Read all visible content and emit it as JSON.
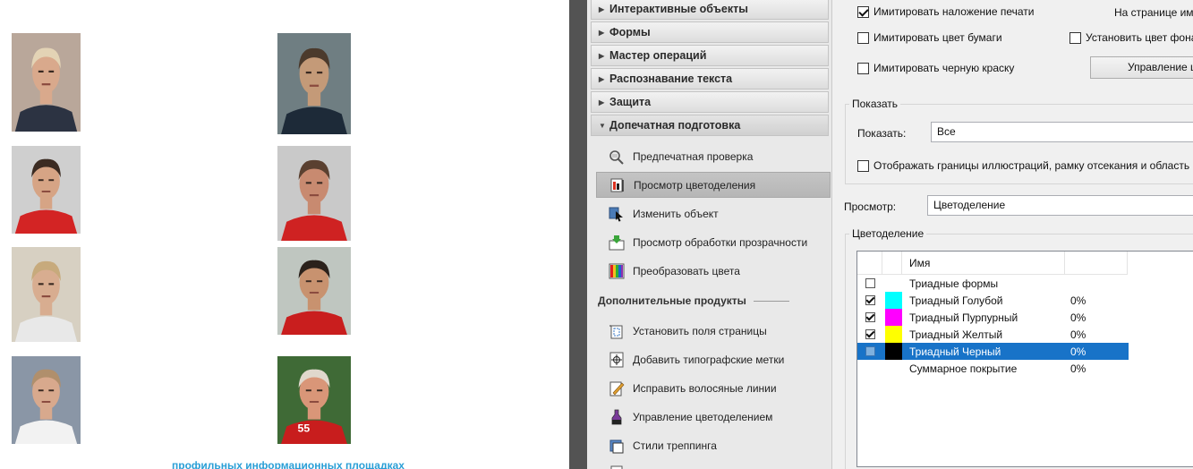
{
  "document": {
    "photos": [
      {
        "name": "photo-1",
        "bg": "#b9a79a",
        "skin": "#d9a98c",
        "hair": "#e3d3b5",
        "shirt": "#2c3342"
      },
      {
        "name": "photo-2",
        "bg": "#6f7e82",
        "skin": "#c49a78",
        "hair": "#4b3a2c",
        "shirt": "#1d2a38"
      },
      {
        "name": "photo-3",
        "bg": "#cfcfcf",
        "skin": "#d6a485",
        "hair": "#3b2b22",
        "shirt": "#d32424"
      },
      {
        "name": "photo-4",
        "bg": "#c9c9c9",
        "skin": "#c88a70",
        "hair": "#5a4030",
        "shirt": "#cf2222"
      },
      {
        "name": "photo-5",
        "bg": "#d7d0c2",
        "skin": "#d8ad90",
        "hair": "#c7aa7c",
        "shirt": "#e8e8e8"
      },
      {
        "name": "photo-6",
        "bg": "#bfc6c0",
        "skin": "#c8926f",
        "hair": "#2b211b",
        "shirt": "#c91e1e"
      },
      {
        "name": "photo-7",
        "bg": "#8a96a6",
        "skin": "#d8a98d",
        "hair": "#b08f6c",
        "shirt": "#f2f2f2"
      },
      {
        "name": "photo-8",
        "bg": "#3f6a36",
        "skin": "#d99678",
        "hair": "#e0d8cc",
        "shirt": "#c81d1d"
      }
    ],
    "photo8_number": "55",
    "link_text": "профильных информационных площадках"
  },
  "tools_panel": {
    "sections": [
      {
        "label": "Интерактивные объекты",
        "open": false
      },
      {
        "label": "Формы",
        "open": false
      },
      {
        "label": "Мастер операций",
        "open": false
      },
      {
        "label": "Распознавание текста",
        "open": false
      },
      {
        "label": "Защита",
        "open": false
      },
      {
        "label": "Допечатная подготовка",
        "open": true
      }
    ],
    "prepress_items": [
      {
        "label": "Предпечатная проверка",
        "icon": "preflight-icon",
        "selected": false
      },
      {
        "label": "Просмотр цветоделения",
        "icon": "output-preview-icon",
        "selected": true
      },
      {
        "label": "Изменить объект",
        "icon": "edit-object-icon",
        "selected": false
      },
      {
        "label": "Просмотр обработки прозрачности",
        "icon": "flattener-preview-icon",
        "selected": false
      },
      {
        "label": "Преобразовать цвета",
        "icon": "convert-colors-icon",
        "selected": false
      }
    ],
    "extra_header": "Дополнительные продукты",
    "extra_items": [
      {
        "label": "Установить поля страницы",
        "icon": "page-boxes-icon"
      },
      {
        "label": "Добавить типографские метки",
        "icon": "printer-marks-icon"
      },
      {
        "label": "Исправить волосяные линии",
        "icon": "fix-hairlines-icon"
      },
      {
        "label": "Управление цветоделением",
        "icon": "ink-manager-icon"
      },
      {
        "label": "Стили треппинга",
        "icon": "trap-presets-icon"
      }
    ]
  },
  "dialog": {
    "simulate_overprint": {
      "label": "Имитировать наложение печати",
      "checked": true
    },
    "on_page_label": "На странице им",
    "simulate_paper": {
      "label": "Имитировать цвет бумаги",
      "checked": false
    },
    "set_page_bg": {
      "label": "Установить цвет фона",
      "checked": false
    },
    "simulate_black": {
      "label": "Имитировать черную краску",
      "checked": false
    },
    "ink_manager_button": "Управление ц",
    "show_group": {
      "title": "Показать",
      "field_label": "Показать:",
      "field_value": "Все",
      "show_art_trim": {
        "label": "Отображать границы иллюстраций, рамку отсекания и область в",
        "checked": false
      }
    },
    "preview_label": "Просмотр:",
    "preview_value": "Цветоделение",
    "separations": {
      "title": "Цветоделение",
      "col_name": "Имя",
      "rows": [
        {
          "name": "Триадные формы",
          "pct": "",
          "checked": false,
          "swatch": "",
          "selected": false
        },
        {
          "name": "Триадный Голубой",
          "pct": "0%",
          "checked": true,
          "swatch": "#00ffff",
          "selected": false
        },
        {
          "name": "Триадный Пурпурный",
          "pct": "0%",
          "checked": true,
          "swatch": "#ff00ff",
          "selected": false
        },
        {
          "name": "Триадный Желтый",
          "pct": "0%",
          "checked": true,
          "swatch": "#ffff00",
          "selected": false
        },
        {
          "name": "Триадный Черный",
          "pct": "0%",
          "checked": false,
          "swatch": "#000000",
          "selected": true
        },
        {
          "name": "Суммарное покрытие",
          "pct": "0%",
          "checked": null,
          "swatch": "",
          "selected": false
        }
      ]
    }
  }
}
